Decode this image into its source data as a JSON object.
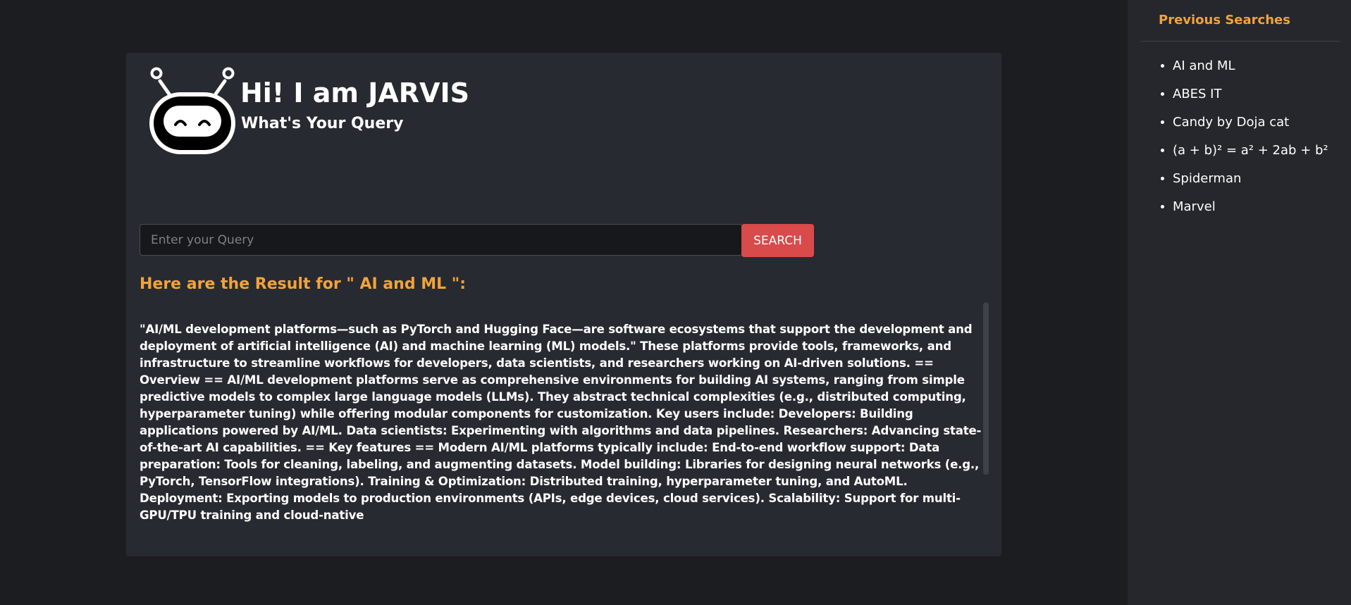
{
  "header": {
    "title": "Hi! I am JARVIS",
    "subtitle": "What's Your Query"
  },
  "search": {
    "placeholder": "Enter your Query",
    "value": "",
    "button_label": "SEARCH"
  },
  "results": {
    "heading": "Here are the Result for \" AI and ML \":",
    "text": "\"AI/ML development platforms—such as PyTorch and Hugging Face—are software ecosystems that support the development and deployment of artificial intelligence (AI) and machine learning (ML) models.\" These platforms provide tools, frameworks, and infrastructure to streamline workflows for developers, data scientists, and researchers working on AI-driven solutions. == Overview == AI/ML development platforms serve as comprehensive environments for building AI systems, ranging from simple predictive models to complex large language models (LLMs). They abstract technical complexities (e.g., distributed computing, hyperparameter tuning) while offering modular components for customization. Key users include: Developers: Building applications powered by AI/ML. Data scientists: Experimenting with algorithms and data pipelines. Researchers: Advancing state-of-the-art AI capabilities. == Key features == Modern AI/ML platforms typically include: End-to-end workflow support: Data preparation: Tools for cleaning, labeling, and augmenting datasets. Model building: Libraries for designing neural networks (e.g., PyTorch, TensorFlow integrations). Training & Optimization: Distributed training, hyperparameter tuning, and AutoML. Deployment: Exporting models to production environments (APIs, edge devices, cloud services). Scalability: Support for multi-GPU/TPU training and cloud-native"
  },
  "sidebar": {
    "title": "Previous Searches",
    "items": [
      "AI and ML",
      "ABES IT",
      "Candy by Doja cat",
      "(a + b)² = a² + 2ab + b²",
      "Spiderman",
      "Marvel"
    ]
  },
  "colors": {
    "accent": "#f2a33a",
    "button": "#d94a4a",
    "background": "#1c1d20",
    "card": "#272a30",
    "sidebar": "#25272c"
  },
  "icons": {
    "logo": "robot-icon"
  }
}
